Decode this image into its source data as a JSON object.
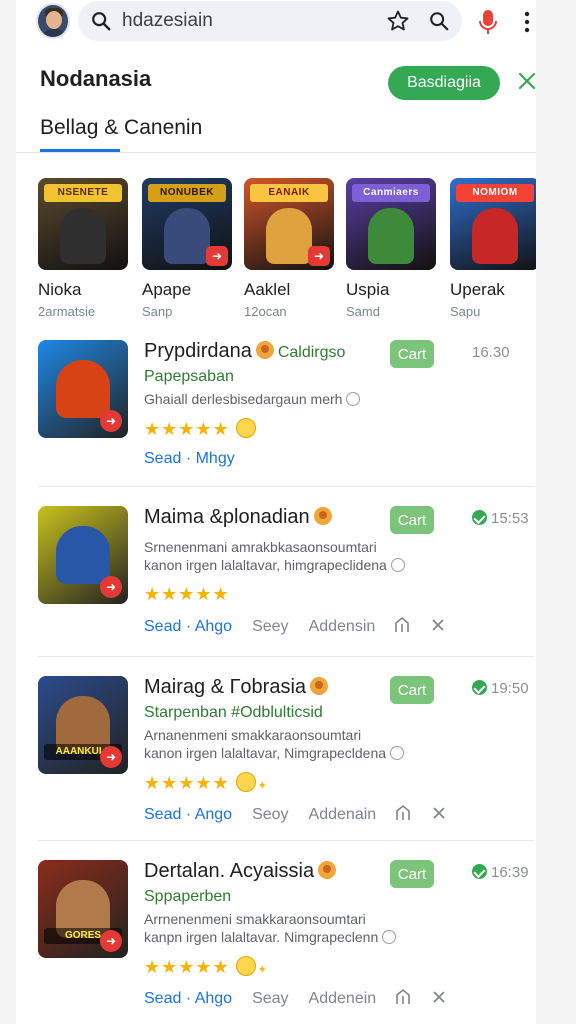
{
  "search": {
    "value": "hdazesiain"
  },
  "header": {
    "title": "Nodanasia",
    "action_label": "Basdiagiia"
  },
  "tab": {
    "label": "Bellag & Canenin"
  },
  "carousel": [
    {
      "name": "Nioka",
      "sub": "2armatsie",
      "banner": "NSENETE",
      "art_bg": "#5d4a2e",
      "banner_bg": "#f1c232",
      "banner_color": "#5a2d00",
      "fig": "#2f2f2f"
    },
    {
      "name": "Apape",
      "sub": "Sanp",
      "banner": "NONUBEK",
      "art_bg": "#1f3c66",
      "banner_bg": "#d4a017",
      "banner_color": "#2b1800",
      "fig": "#394b7a"
    },
    {
      "name": "Aaklel",
      "sub": "12ocan",
      "banner": "EANAIK",
      "art_bg": "#d2572b",
      "banner_bg": "#f9c440",
      "banner_color": "#7a1c00",
      "fig": "#e0a23e"
    },
    {
      "name": "Uspia",
      "sub": "Samd",
      "banner": "Canmiaers",
      "art_bg": "#5a3fa3",
      "banner_bg": "#7d5fd6",
      "banner_color": "#ffffff",
      "fig": "#3d8a3a"
    },
    {
      "name": "Uperak",
      "sub": "Sapu",
      "banner": "NOMIOM",
      "art_bg": "#2f6fd1",
      "banner_bg": "#f44336",
      "banner_color": "#ffffff",
      "fig": "#c62828"
    }
  ],
  "list": [
    {
      "title": "Prypdirdana",
      "tag": "Caldirgso",
      "cart": "Cart",
      "time": "16.30",
      "verified": false,
      "subtitle": "Papepsaban",
      "desc": [
        "Ghaiall derlesbisedargaun merh"
      ],
      "stars": "★★★★★",
      "actions": {
        "link": "Sead · Mhgy",
        "secondary": "",
        "tertiary": ""
      },
      "icon_bg": "#1e88e5",
      "icon_fig": "#d84315",
      "icon_banner": ""
    },
    {
      "title": "Maima &plonadian",
      "tag": "",
      "cart": "Cart",
      "time": "15:53",
      "verified": true,
      "subtitle": "",
      "desc": [
        "Srnenenmani amrakbkasaonsoumtari",
        "kanon irgen lalaltavar, himgrapeclidena"
      ],
      "stars": "★★★★★",
      "actions": {
        "link": "Sead · Ahgo",
        "secondary": "Seey",
        "tertiary": "Addensin"
      },
      "icon_bg": "#c8c21d",
      "icon_fig": "#2857a8",
      "icon_banner": ""
    },
    {
      "title": "Mairag & Гobrasia",
      "tag": "",
      "cart": "Cart",
      "time": "19:50",
      "verified": true,
      "subtitle": "Starpenban #Odblulticsid",
      "desc": [
        "Arnanenmeni smakkaraonsoumtari",
        "kanon irgen lalaltavar, Nimgrapecldena"
      ],
      "stars": "★★★★★",
      "actions": {
        "link": "Sead · Ango",
        "secondary": "Seoy",
        "tertiary": "Addenain"
      },
      "icon_bg": "#2b4c8c",
      "icon_fig": "#a06a3c",
      "icon_banner": "AAANKUL5"
    },
    {
      "title": "Dertalan. Acyaissia",
      "tag": "",
      "cart": "Cart",
      "time": "16:39",
      "verified": true,
      "subtitle": "Sppaperben",
      "desc": [
        "Arrnenenmeni smakkaraonsoumtari",
        "kanpn irgen lalaltavar. Nimgrapeclenn"
      ],
      "stars": "★★★★★",
      "actions": {
        "link": "Sead · Ahgo",
        "secondary": "Seay",
        "tertiary": "Addenein"
      },
      "icon_bg": "#8a2d1a",
      "icon_fig": "#b07a4a",
      "icon_banner": "GORES"
    }
  ],
  "colors": {
    "accent": "#1a73e8",
    "green": "#34a853",
    "star": "#f4b400",
    "mic": "#ea4335"
  }
}
